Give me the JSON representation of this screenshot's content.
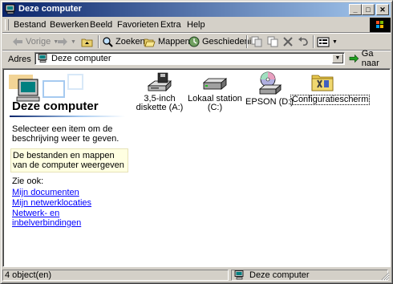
{
  "window": {
    "title": "Deze computer"
  },
  "title_buttons": {
    "minimize": "_",
    "maximize": "□",
    "close": "✕"
  },
  "menu": [
    "Bestand",
    "Bewerken",
    "Beeld",
    "Favorieten",
    "Extra",
    "Help"
  ],
  "toolbar": {
    "back_label": "Vorige",
    "search_label": "Zoeken",
    "folders_label": "Mappen",
    "history_label": "Geschiedenis"
  },
  "address": {
    "label": "Adres",
    "value": "Deze computer",
    "go_label": "Ga naar"
  },
  "left_panel": {
    "title": "Deze computer",
    "description": "Selecteer een item om de beschrijving weer te geven.",
    "hint": "De bestanden en mappen van de computer weergeven",
    "see_also_label": "Zie ook:",
    "links": [
      "Mijn documenten",
      "Mijn netwerklocaties",
      "Netwerk- en inbelverbindingen"
    ]
  },
  "items": [
    {
      "label": "3,5-inch diskette (A:)",
      "icon": "floppy-drive-icon"
    },
    {
      "label": "Lokaal station (C:)",
      "icon": "hard-drive-icon"
    },
    {
      "label": "EPSON (D:)",
      "icon": "cd-drive-icon"
    },
    {
      "label": "Configuratiescherm",
      "icon": "control-panel-icon"
    }
  ],
  "status": {
    "count": "4 object(en)",
    "location": "Deze computer"
  },
  "colors": {
    "title_start": "#0a246a",
    "title_end": "#a6caf0",
    "link": "#0000ff",
    "face": "#d4d0c8"
  }
}
